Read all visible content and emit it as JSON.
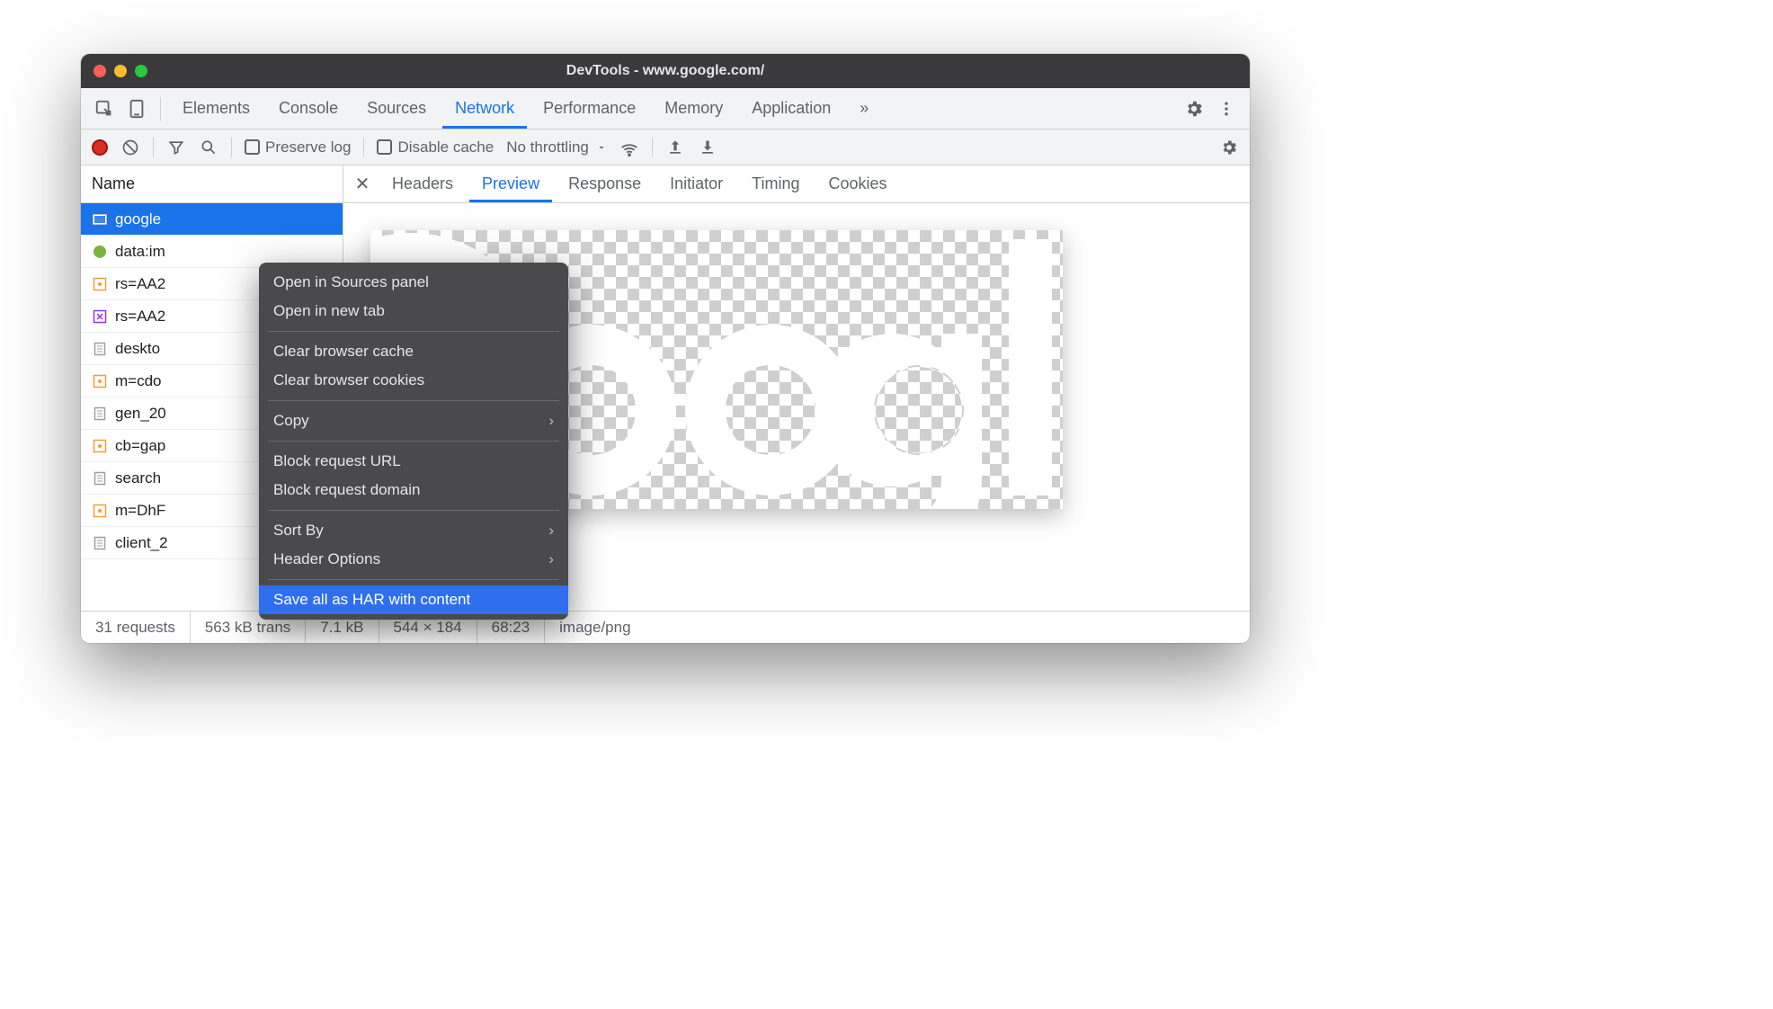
{
  "window": {
    "title": "DevTools - www.google.com/"
  },
  "tabs": {
    "items": [
      "Elements",
      "Console",
      "Sources",
      "Network",
      "Performance",
      "Memory",
      "Application"
    ],
    "active": "Network",
    "more": "»"
  },
  "toolbar": {
    "preserve_log": "Preserve log",
    "disable_cache": "Disable cache",
    "throttling": "No throttling"
  },
  "sidebar": {
    "header": "Name",
    "rows": [
      {
        "label": "google",
        "type": "image",
        "selected": true
      },
      {
        "label": "data:im",
        "type": "leaf"
      },
      {
        "label": "rs=AA2",
        "type": "js-o"
      },
      {
        "label": "rs=AA2",
        "type": "css"
      },
      {
        "label": "deskto",
        "type": "doc"
      },
      {
        "label": "m=cdo",
        "type": "js-o"
      },
      {
        "label": "gen_20",
        "type": "doc"
      },
      {
        "label": "cb=gap",
        "type": "js-o"
      },
      {
        "label": "search",
        "type": "doc"
      },
      {
        "label": "m=DhF",
        "type": "js-o"
      },
      {
        "label": "client_2",
        "type": "doc"
      }
    ]
  },
  "detail_tabs": {
    "items": [
      "Headers",
      "Preview",
      "Response",
      "Initiator",
      "Timing",
      "Cookies"
    ],
    "active": "Preview"
  },
  "context_menu": {
    "open_sources": "Open in Sources panel",
    "open_tab": "Open in new tab",
    "clear_cache": "Clear browser cache",
    "clear_cookies": "Clear browser cookies",
    "copy": "Copy",
    "block_url": "Block request URL",
    "block_domain": "Block request domain",
    "sort_by": "Sort By",
    "header_options": "Header Options",
    "save_har": "Save all as HAR with content"
  },
  "status": {
    "requests": "31 requests",
    "transferred": "563 kB trans",
    "resources": "7.1 kB",
    "dimensions": "544 × 184",
    "time": "68:23",
    "mime": "image/png"
  }
}
